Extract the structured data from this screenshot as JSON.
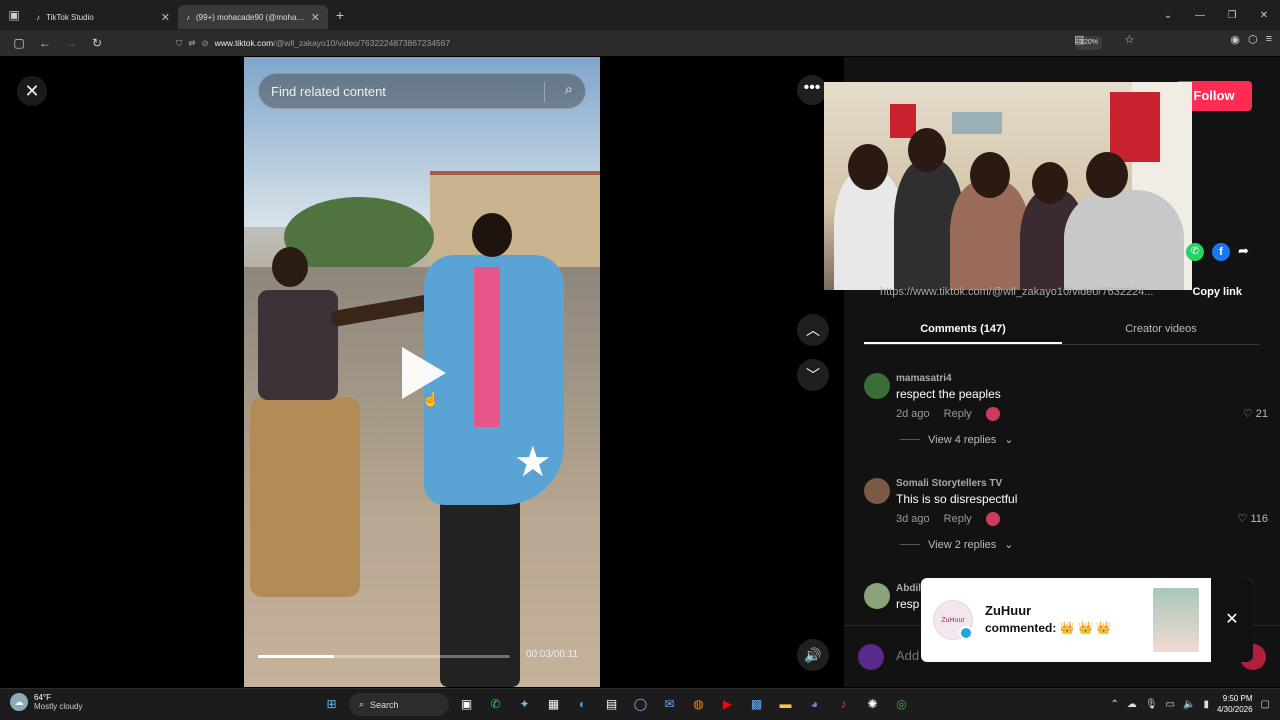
{
  "browser": {
    "tabs": [
      {
        "title": "TikTok Studio",
        "active": false
      },
      {
        "title": "(99+) mohacade90 (@mohaclip",
        "active": true
      }
    ],
    "url_domain": "www.tiktok.com",
    "url_path": "/@wll_zakayo10/video/7632224873867234567",
    "zoom": "120%"
  },
  "player": {
    "search_placeholder": "Find related content",
    "progress": 0.3,
    "timecode": "00:03/00:11"
  },
  "panel": {
    "follow_label": "Follow",
    "share_url": "https://www.tiktok.com/@wll_zakayo10/video/7632224...",
    "copy_label": "Copy link",
    "tabs": [
      "Comments (147)",
      "Creator videos"
    ],
    "comments": [
      {
        "user": "mamasatri4",
        "text": "respect the peaples",
        "age": "2d ago",
        "reply": "Reply",
        "likes": "21",
        "replies": "View 4 replies",
        "color": "#3b6d3a"
      },
      {
        "user": "Somali Storytellers TV",
        "text": "This is so disrespectful",
        "age": "3d ago",
        "reply": "Reply",
        "likes": "116",
        "replies": "View 2 replies",
        "color": "#7a5a45"
      },
      {
        "user": "Abdil",
        "text": "resp",
        "color": "#8aa37a"
      }
    ],
    "add_placeholder": "Add"
  },
  "toast": {
    "avatar_text": "ZuHuur",
    "name": "ZuHuur",
    "text": "commented: 👑 👑 👑"
  },
  "taskbar": {
    "temp": "64°F",
    "weather": "Mostly cloudy",
    "search": "Search",
    "time": "9:50 PM",
    "date": "4/30/2026"
  }
}
